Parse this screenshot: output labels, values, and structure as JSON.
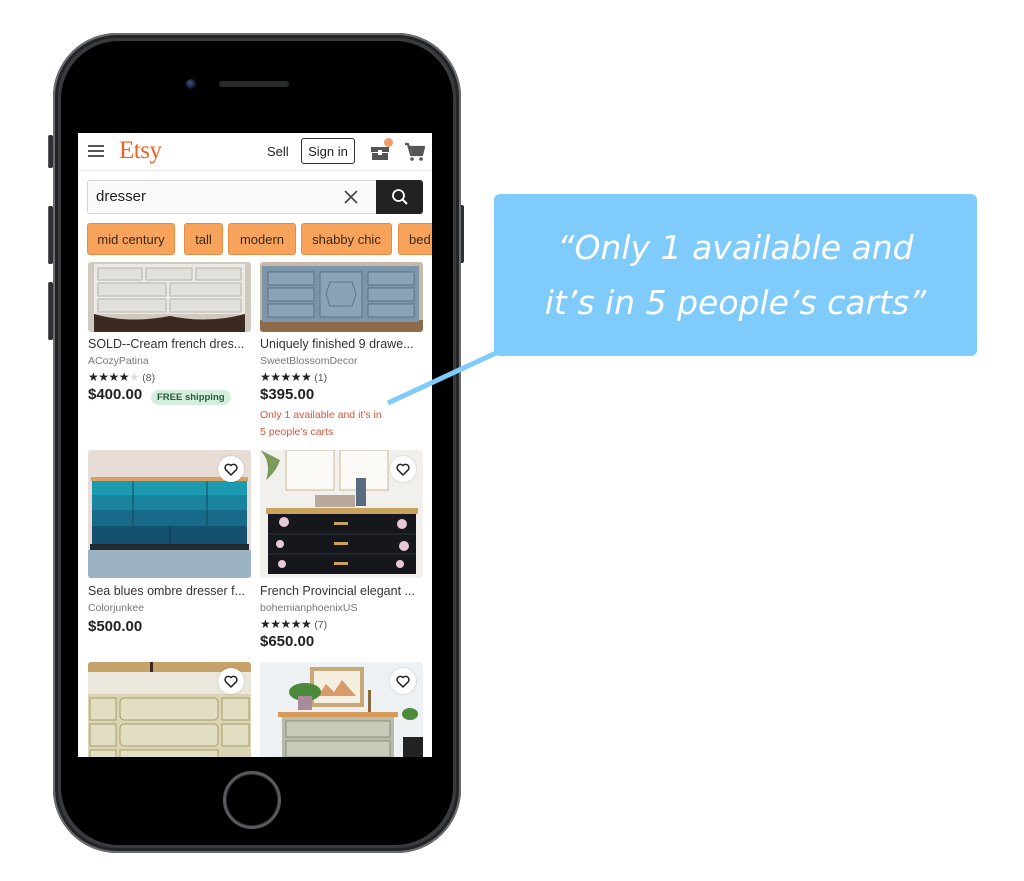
{
  "header": {
    "logo": "Etsy",
    "sell_label": "Sell",
    "signin_label": "Sign in",
    "brand_color": "#f1641e"
  },
  "search": {
    "value": "dresser",
    "placeholder": "Search for anything"
  },
  "chips": [
    "mid century",
    "tall",
    "modern",
    "shabby chic",
    "bed"
  ],
  "listings": [
    {
      "title": "SOLD--Cream french dres...",
      "shop": "ACozyPatina",
      "rating": 4,
      "reviews": "(8)",
      "price": "$400.00",
      "badge": "FREE shipping",
      "scarcity": ""
    },
    {
      "title": "Uniquely finished 9 drawe...",
      "shop": "SweetBlossomDecor",
      "rating": 5,
      "reviews": "(1)",
      "price": "$395.00",
      "badge": "",
      "scarcity_line1": "Only 1 available and it's in",
      "scarcity_line2": "5 people's carts"
    },
    {
      "title": "Sea blues ombre dresser f...",
      "shop": "Colorjunkee",
      "price": "$500.00"
    },
    {
      "title": "French Provincial elegant ...",
      "shop": "bohemianphoenixUS",
      "rating": 5,
      "reviews": "(7)",
      "price": "$650.00"
    },
    {
      "title": "",
      "shop": ""
    },
    {
      "title": "",
      "shop": ""
    }
  ],
  "icons": {
    "menu": "hamburger-icon",
    "gift": "gift-box-icon",
    "cart": "cart-icon",
    "clear": "close-icon",
    "search": "search-icon",
    "favorite": "heart-icon"
  },
  "callout": {
    "line1": "“Only 1 available and",
    "line2": "it’s in 5 people’s carts”",
    "color": "#7fcbfb"
  }
}
